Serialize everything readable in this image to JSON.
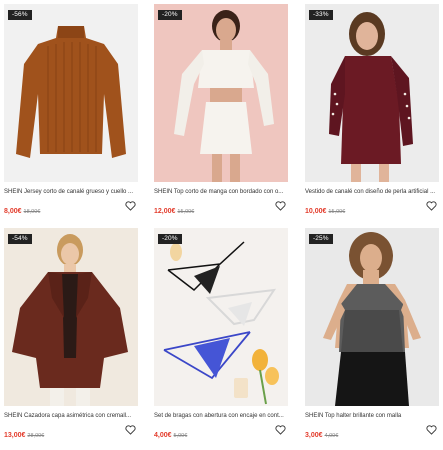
{
  "products": [
    {
      "discount": "-56%",
      "title": "SHEIN Jersey corto de canalé grueso y cuello ...",
      "price": "8,00€",
      "old_price": "18,00€"
    },
    {
      "discount": "-20%",
      "title": "SHEIN Top corto de manga con bordado con o...",
      "price": "12,00€",
      "old_price": "15,00€"
    },
    {
      "discount": "-33%",
      "title": "Vestido de canalé con diseño de perla artificial ...",
      "price": "10,00€",
      "old_price": "15,00€"
    },
    {
      "discount": "-54%",
      "title": "SHEIN Cazadora capa asimétrica con cremall...",
      "price": "13,00€",
      "old_price": "28,00€"
    },
    {
      "discount": "-20%",
      "title": "Set de bragas con abertura con encaje en cont...",
      "price": "4,00€",
      "old_price": "5,00€"
    },
    {
      "discount": "-25%",
      "title": "SHEIN Top halter brillante con malla",
      "price": "3,00€",
      "old_price": "4,00€"
    }
  ],
  "colors": {
    "price": "#e33b2b",
    "badge_bg": "#222222"
  },
  "icons": {
    "wishlist": "heart-outline-icon"
  }
}
